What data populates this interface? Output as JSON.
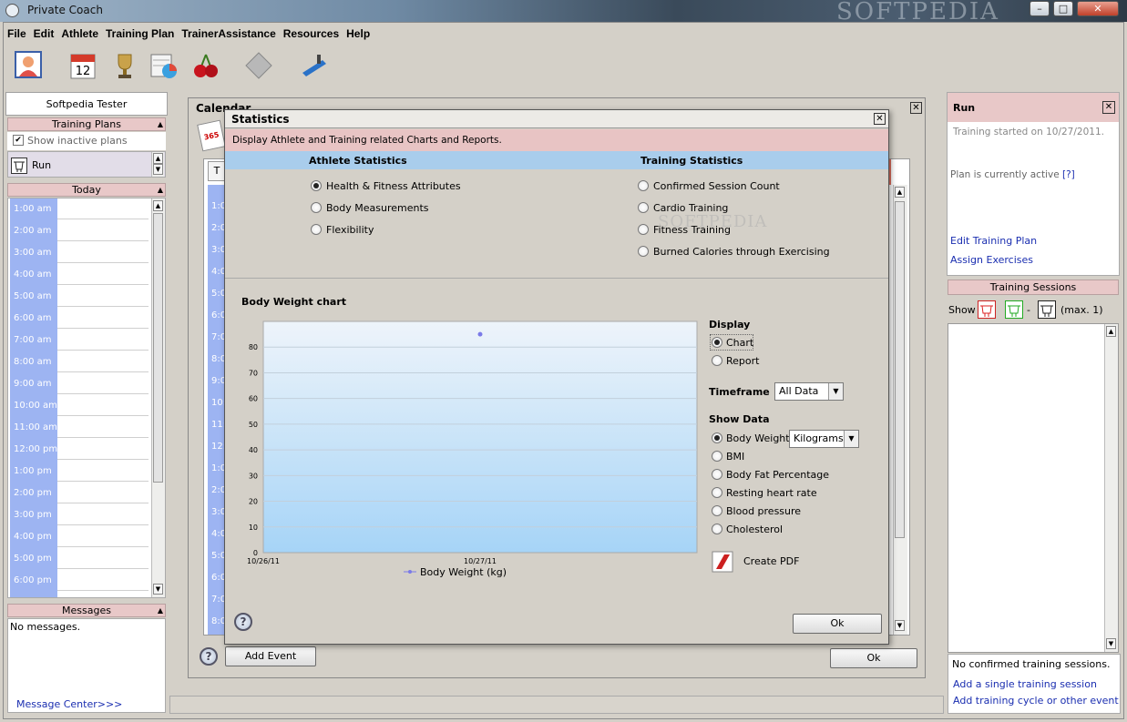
{
  "window": {
    "title": "Private Coach",
    "watermark": "SOFTPEDIA",
    "min": "–",
    "max": "□",
    "close": "✕"
  },
  "menu": [
    "File",
    "Edit",
    "Athlete",
    "Training Plan",
    "TrainerAssistance",
    "Resources",
    "Help"
  ],
  "toolbar_icons": [
    "athlete-icon",
    "calendar-icon",
    "trophy-icon",
    "statistics-icon",
    "cherries-icon",
    "diamond-icon",
    "treadmill-icon"
  ],
  "calendar_day": "12",
  "left": {
    "athlete": "Softpedia Tester",
    "plans_header": "Training Plans",
    "show_inactive": "Show inactive plans",
    "plan": "Run",
    "today_header": "Today",
    "times": [
      "1:00 am",
      "2:00 am",
      "3:00 am",
      "4:00 am",
      "5:00 am",
      "6:00 am",
      "7:00 am",
      "8:00 am",
      "9:00 am",
      "10:00 am",
      "11:00 am",
      "12:00 pm",
      "1:00 pm",
      "2:00 pm",
      "3:00 pm",
      "4:00 pm",
      "5:00 pm",
      "6:00 pm"
    ],
    "messages_header": "Messages",
    "no_messages": "No messages.",
    "message_center": "Message Center>>>"
  },
  "calendar": {
    "title": "Calendar",
    "close": "✕",
    "badge": "365",
    "tab_char": "T",
    "partial_times": [
      "1:0",
      "2:0",
      "3:0",
      "4:0",
      "5:0",
      "6:0",
      "7:0",
      "8:0",
      "9:0",
      "10:",
      "11:",
      "12:",
      "1:0",
      "2:0",
      "3:0",
      "4:0",
      "5:0",
      "6:0",
      "7:0",
      "8:0"
    ],
    "add_event": "Add Event",
    "ok": "Ok",
    "help": "?"
  },
  "dialog": {
    "title": "Statistics",
    "close": "✕",
    "subtitle": "Display Athlete and Training related Charts and Reports.",
    "athlete_header": "Athlete Statistics",
    "athlete_options": [
      "Health & Fitness Attributes",
      "Body Measurements",
      "Flexibility"
    ],
    "training_header": "Training Statistics",
    "training_options": [
      "Confirmed Session Count",
      "Cardio Training",
      "Fitness Training",
      "Burned Calories through Exercising"
    ],
    "watermark": "SOFTPEDIA",
    "chart_title": "Body Weight chart",
    "display_label": "Display",
    "display_options": [
      "Chart",
      "Report"
    ],
    "timeframe_label": "Timeframe",
    "timeframe_value": "All Data",
    "showdata_label": "Show Data",
    "showdata_options": [
      "Body Weight",
      "BMI",
      "Body Fat Percentage",
      "Resting heart rate",
      "Blood pressure",
      "Cholesterol"
    ],
    "unit_value": "Kilograms",
    "create_pdf": "Create PDF",
    "ok": "Ok",
    "help": "?"
  },
  "chart_data": {
    "type": "scatter",
    "title": "Body Weight chart",
    "xlabel": "",
    "ylabel": "",
    "x_ticks": [
      "10/26/11",
      "10/27/11"
    ],
    "y_ticks": [
      0,
      10,
      20,
      30,
      40,
      50,
      60,
      70,
      80
    ],
    "ylim": [
      0,
      90
    ],
    "series": [
      {
        "name": "Body Weight (kg)",
        "x": [
          "10/27/11"
        ],
        "values": [
          85
        ]
      }
    ],
    "legend": "bottom",
    "grid": true,
    "colors": {
      "point": "#7a7ae8",
      "plot_top": "#eef4fa",
      "plot_bottom": "#a6d4f7"
    }
  },
  "right": {
    "plan_title": "Run",
    "close": "✕",
    "started": "Training started on 10/27/2011.",
    "active": "Plan is currently active",
    "active_help": "[?]",
    "edit_plan": "Edit Training Plan",
    "assign": "Assign Exercises",
    "sessions_header": "Training Sessions",
    "show_label": "Show",
    "dash": "-",
    "max_label": "(max. 1)",
    "no_sessions": "No confirmed training sessions.",
    "add_single": "Add a single training session",
    "add_cycle": "Add training cycle or other event"
  }
}
